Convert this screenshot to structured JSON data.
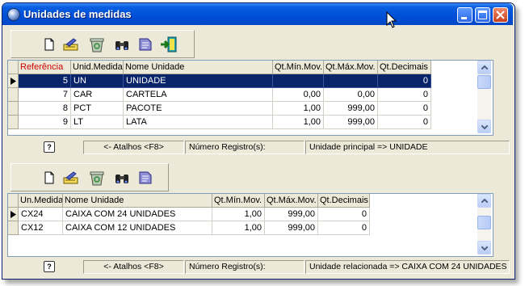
{
  "window": {
    "title": "Unidades de medidas"
  },
  "top_grid": {
    "columns": [
      "Referência",
      "Unid.Medida",
      "Nome Unidade",
      "Qt.Mín.Mov.",
      "Qt.Máx.Mov.",
      "Qt.Decimais"
    ],
    "rows": [
      {
        "ref": "5",
        "unid": "UN",
        "nome": "UNIDADE",
        "qmin": "",
        "qmax": "",
        "qdec": "0",
        "selected": true
      },
      {
        "ref": "7",
        "unid": "CAR",
        "nome": "CARTELA",
        "qmin": "0,00",
        "qmax": "0,00",
        "qdec": "0"
      },
      {
        "ref": "8",
        "unid": "PCT",
        "nome": "PACOTE",
        "qmin": "1,00",
        "qmax": "999,00",
        "qdec": "0"
      },
      {
        "ref": "9",
        "unid": "LT",
        "nome": "LATA",
        "qmin": "1,00",
        "qmax": "999,00",
        "qdec": "0"
      }
    ]
  },
  "top_status": {
    "help": "?",
    "shortcuts": "<- Atalhos <F8>",
    "records": "Número Registro(s):",
    "info": "Unidade principal => UNIDADE"
  },
  "bottom_grid": {
    "columns": [
      "Un.Medida",
      "Nome Unidade",
      "Qt.Mín.Mov.",
      "Qt.Máx.Mov.",
      "Qt.Decimais"
    ],
    "rows": [
      {
        "unid": "CX24",
        "nome": "CAIXA COM 24 UNIDADES",
        "qmin": "1,00",
        "qmax": "999,00",
        "qdec": "0",
        "current": true
      },
      {
        "unid": "CX12",
        "nome": "CAIXA COM 12 UNIDADES",
        "qmin": "1,00",
        "qmax": "999,00",
        "qdec": "0"
      }
    ]
  },
  "bottom_status": {
    "help": "?",
    "shortcuts": "<- Atalhos <F8>",
    "records": "Número Registro(s):",
    "info": "Unidade relacionada => CAIXA COM 24 UNIDADES"
  },
  "colors": {
    "titlebar": "#0050d8",
    "selection": "#0a246a",
    "header_accent": "#cc0000",
    "face": "#ece9d8"
  },
  "icons": {
    "top_toolbar": [
      "new-document-icon",
      "edit-icon",
      "recycle-bin-icon",
      "binoculars-icon",
      "print-icon",
      "exit-icon"
    ],
    "bottom_toolbar": [
      "new-document-icon",
      "edit-icon",
      "recycle-bin-icon",
      "binoculars-icon",
      "print-icon"
    ]
  }
}
